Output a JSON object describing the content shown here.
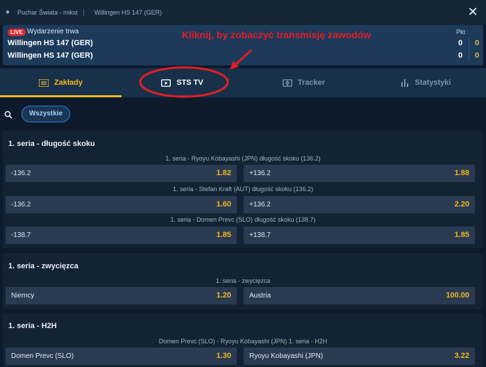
{
  "topbar": {
    "breadcrumb_1": "Puchar Świata - mikst",
    "breadcrumb_2": "Willingen HS 147 (GER)"
  },
  "scoreboard": {
    "live_badge": "LIVE",
    "live_status": "Wydarzenie trwa",
    "pkt_label": "Pkt",
    "rows": [
      {
        "team": "Willingen HS 147 (GER)",
        "score_a": "0",
        "score_b": "0"
      },
      {
        "team": "Willingen HS 147 (GER)",
        "score_a": "0",
        "score_b": "0"
      }
    ]
  },
  "annotation": {
    "text": "Kliknij, by zobaczyć transmisję zawodów"
  },
  "tabs": [
    {
      "label": "Zakłady",
      "icon": "list-icon"
    },
    {
      "label": "STS TV",
      "icon": "tv-icon"
    },
    {
      "label": "Tracker",
      "icon": "tracker-icon"
    },
    {
      "label": "Statystyki",
      "icon": "stats-icon"
    }
  ],
  "filter": {
    "chip": "Wszystkie"
  },
  "sections": [
    {
      "title": "1. seria - długość skoku",
      "markets": [
        {
          "subtitle": "1. seria - Ryoyu Kobayashi (JPN) długość skoku (136.2)",
          "left": {
            "label": "-136.2",
            "odds": "1.82"
          },
          "right": {
            "label": "+136.2",
            "odds": "1.88"
          }
        },
        {
          "subtitle": "1. seria - Stefan Kraft (AUT) długość skoku (136.2)",
          "left": {
            "label": "-136.2",
            "odds": "1.60"
          },
          "right": {
            "label": "+136.2",
            "odds": "2.20"
          }
        },
        {
          "subtitle": "1. seria - Domen Prevc (SLO) długość skoku (138.7)",
          "left": {
            "label": "-138.7",
            "odds": "1.85"
          },
          "right": {
            "label": "+138.7",
            "odds": "1.85"
          }
        }
      ]
    },
    {
      "title": "1. seria - zwycięzca",
      "markets": [
        {
          "subtitle": "1. seria - zwycięzca",
          "left": {
            "label": "Niemcy",
            "odds": "1.20"
          },
          "right": {
            "label": "Austria",
            "odds": "100.00"
          }
        }
      ]
    },
    {
      "title": "1. seria - H2H",
      "markets": [
        {
          "subtitle": "Domen Prevc (SLO) - Ryoyu Kobayashi (JPN) 1. seria - H2H",
          "left": {
            "label": "Domen Prevc (SLO)",
            "odds": "1.30"
          },
          "right": {
            "label": "Ryoyu Kobayashi (JPN)",
            "odds": "3.22"
          }
        }
      ]
    }
  ],
  "colors": {
    "accent": "#f0b723",
    "live": "#d9262b",
    "annotation": "#e31e24",
    "background": "#0d1a2b"
  }
}
